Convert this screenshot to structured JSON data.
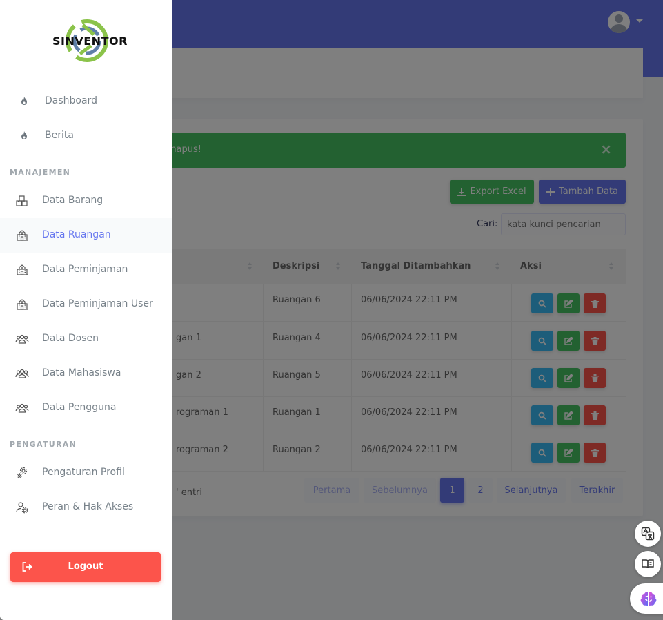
{
  "app": {
    "logo_text": "SINVENTOR"
  },
  "sidebar": {
    "top_items": [
      {
        "label": "Dashboard",
        "icon": "fire-icon"
      },
      {
        "label": "Berita",
        "icon": "fire-icon"
      }
    ],
    "sections": [
      {
        "header": "MANAJEMEN",
        "items": [
          {
            "label": "Data Barang",
            "icon": "boxes-icon",
            "active": false
          },
          {
            "label": "Data Ruangan",
            "icon": "school-icon",
            "active": true
          },
          {
            "label": "Data Peminjaman",
            "icon": "school-icon",
            "active": false
          },
          {
            "label": "Data Peminjaman User",
            "icon": "school-icon",
            "active": false
          },
          {
            "label": "Data Dosen",
            "icon": "users-icon",
            "active": false
          },
          {
            "label": "Data Mahasiswa",
            "icon": "users-icon",
            "active": false
          },
          {
            "label": "Data Pengguna",
            "icon": "users-icon",
            "active": false
          }
        ]
      },
      {
        "header": "PENGATURAN",
        "items": [
          {
            "label": "Pengaturan Profil",
            "icon": "gears-icon",
            "active": false
          },
          {
            "label": "Peran & Hak Akses",
            "icon": "user-gear-icon",
            "active": false
          }
        ]
      }
    ],
    "logout_label": "Logout"
  },
  "alert": {
    "message": "hapus!",
    "close": "×"
  },
  "toolbar": {
    "export_label": "Export Excel",
    "add_label": "Tambah Data"
  },
  "search": {
    "label": "Cari:",
    "placeholder": "kata kunci pencarian"
  },
  "table": {
    "columns": [
      "Deskripsi",
      "Tanggal Ditambahkan",
      "Aksi"
    ],
    "rows": [
      {
        "name": "",
        "description": "Ruangan 6",
        "date": "06/06/2024 22:11 PM"
      },
      {
        "name": "gan 1",
        "description": "Ruangan 4",
        "date": "06/06/2024 22:11 PM"
      },
      {
        "name": "gan 2",
        "description": "Ruangan 5",
        "date": "06/06/2024 22:11 PM"
      },
      {
        "name": "rograman 1",
        "description": "Ruangan 1",
        "date": "06/06/2024 22:11 PM"
      },
      {
        "name": "rograman 2",
        "description": "Ruangan 2",
        "date": "06/06/2024 22:11 PM"
      }
    ]
  },
  "footer": {
    "info": "' entri"
  },
  "pagination": {
    "first": "Pertama",
    "prev": "Sebelumnya",
    "pages": [
      "1",
      "2"
    ],
    "current": "1",
    "next": "Selanjutnya",
    "last": "Terakhir"
  },
  "colors": {
    "primary": "#6777ef",
    "success": "#47c363",
    "info": "#3abaf4",
    "danger": "#fc544b"
  }
}
